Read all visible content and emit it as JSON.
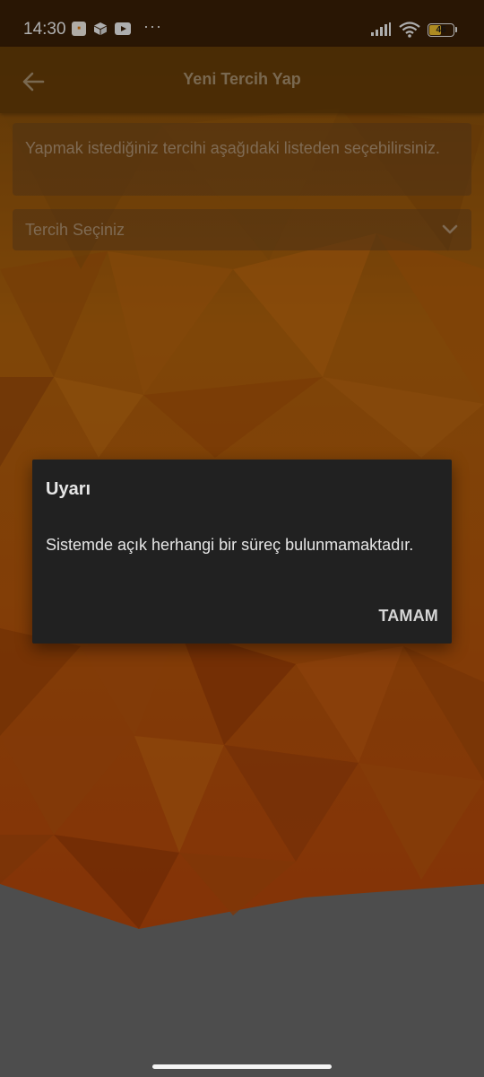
{
  "status_bar": {
    "time": "14:30",
    "battery_level": "45",
    "icons": [
      "news-app-icon",
      "box-icon",
      "youtube-icon",
      "more-dots-icon",
      "signal-icon",
      "wifi-icon",
      "battery-icon"
    ]
  },
  "app_bar": {
    "title": "Yeni Tercih Yap",
    "back_icon": "arrow-left-icon"
  },
  "info_panel": {
    "text": "Yapmak istediğiniz tercihi aşağıdaki listeden seçebilirsiniz."
  },
  "select": {
    "placeholder": "Tercih Seçiniz",
    "icon": "chevron-down-icon"
  },
  "dialog": {
    "title": "Uyarı",
    "message": "Sistemde açık herhangi bir süreç bulunmamaktadır.",
    "ok_label": "TAMAM"
  },
  "colors": {
    "background_orange": "#b5520a",
    "app_bar": "#5f3908",
    "dialog_bg": "#212121",
    "bottom_gray": "#6b6b6b"
  }
}
